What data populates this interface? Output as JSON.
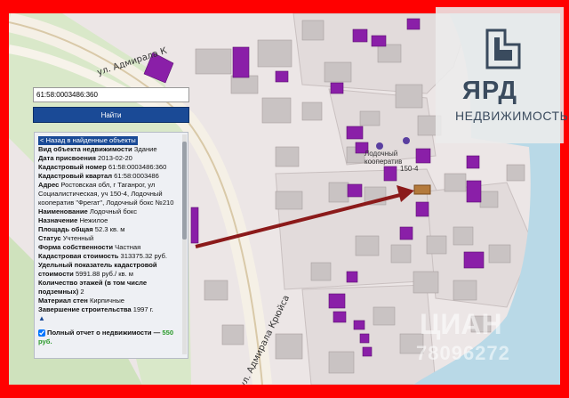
{
  "map": {
    "street_top": "ул. Адмирала К",
    "street_bottom": "ул. Адмирала Крюйса",
    "coop_label": "Лодочный кооператив",
    "number_label": "150-4"
  },
  "search": {
    "value": "61:58:0003486:360",
    "button_label": "Найти"
  },
  "card": {
    "back_link": "< Назад в найденные объекты",
    "rows": [
      {
        "label": "Вид объекта недвижимости",
        "value": "Здание"
      },
      {
        "label": "Дата присвоения",
        "value": "2013-02-20"
      },
      {
        "label": "Кадастровый номер",
        "value": "61:58:0003486:360"
      },
      {
        "label": "Кадастровый квартал",
        "value": "61:58:0003486"
      },
      {
        "label": "Адрес",
        "value": "Ростовская обл, г Таганрог, ул Социалистическая, уч 150-4, Лодочный кооператив \"Фрегат\", Лодочный бокс №210"
      },
      {
        "label": "Наименование",
        "value": "Лодочный бокс"
      },
      {
        "label": "Назначение",
        "value": "Нежилое"
      },
      {
        "label": "Площадь общая",
        "value": "52.3 кв. м"
      },
      {
        "label": "Статус",
        "value": "Учтенный"
      },
      {
        "label": "Форма собственности",
        "value": "Частная"
      },
      {
        "label": "Кадастровая стоимость",
        "value": "313375.32 руб."
      },
      {
        "label": "Удельный показатель кадастровой стоимости",
        "value": "5991.88 руб./ кв. м"
      },
      {
        "label": "Количество этажей (в том числе подземных)",
        "value": "2"
      },
      {
        "label": "Материал стен",
        "value": "Кирпичные"
      },
      {
        "label": "Завершение строительства",
        "value": "1997 г."
      }
    ],
    "report_label": "Полный отчет о недвижимости —",
    "report_price": "550 руб."
  },
  "logo": {
    "brand": "ЯРД",
    "tagline": "НЕДВИЖИМОСТЬ"
  },
  "watermark": {
    "top": "ЦИАН",
    "bottom": "78096272"
  },
  "colors": {
    "frame": "#ff0000",
    "building": "#8a1fa8",
    "water": "#b9d9e7",
    "arrow": "#8b1a1a",
    "button": "#1a4a96"
  }
}
